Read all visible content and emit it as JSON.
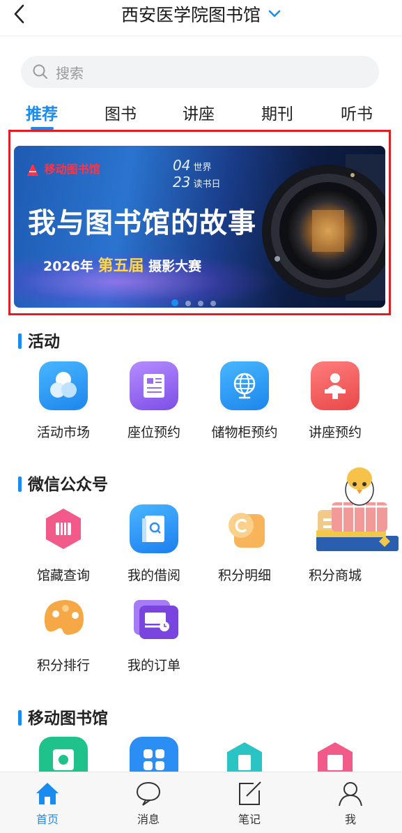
{
  "header": {
    "title": "西安医学院图书馆"
  },
  "search": {
    "placeholder": "搜索"
  },
  "tabs": [
    {
      "label": "推荐",
      "active": true
    },
    {
      "label": "图书",
      "active": false
    },
    {
      "label": "讲座",
      "active": false
    },
    {
      "label": "期刊",
      "active": false
    },
    {
      "label": "听书",
      "active": false
    }
  ],
  "banner": {
    "logo_text": "移动图书馆",
    "date_top_num": "04",
    "date_top_label": "世界",
    "date_bottom_num": "23",
    "date_bottom_label": "读书日",
    "headline": "我与图书馆的故事",
    "sub_year": "2026年",
    "sub_highlight": "第五届",
    "sub_rest": "摄影大赛",
    "slide_count": 4,
    "active_slide": 0
  },
  "sections": {
    "activities": {
      "title": "活动",
      "items": [
        {
          "label": "活动市场",
          "icon": "activity-market-icon",
          "color": "#2a9ef5"
        },
        {
          "label": "座位预约",
          "icon": "seat-reservation-icon",
          "color": "#9a6cf0"
        },
        {
          "label": "储物柜预约",
          "icon": "locker-reservation-icon",
          "color": "#2a9ef5"
        },
        {
          "label": "讲座预约",
          "icon": "lecture-reservation-icon",
          "color": "#f05a5a"
        }
      ]
    },
    "wechat": {
      "title": "微信公众号",
      "items": [
        {
          "label": "馆藏查询",
          "icon": "collection-search-icon",
          "color": "#f25a8a"
        },
        {
          "label": "我的借阅",
          "icon": "my-borrowing-icon",
          "color": "#2a8ef5"
        },
        {
          "label": "积分明细",
          "icon": "points-detail-icon",
          "color": "#f5a23a"
        },
        {
          "label": "积分商城",
          "icon": "points-mall-icon",
          "color": "#f0b060"
        },
        {
          "label": "积分排行",
          "icon": "points-ranking-icon",
          "color": "#f5a23a"
        },
        {
          "label": "我的订单",
          "icon": "my-orders-icon",
          "color": "#8a52e0"
        }
      ]
    },
    "mobile_library": {
      "title": "移动图书馆",
      "items": [
        {
          "icon": "mobile-lib-camera-icon",
          "color": "#1fc28a"
        },
        {
          "icon": "mobile-lib-apps-icon",
          "color": "#2a8ef5"
        },
        {
          "icon": "mobile-lib-doc-icon",
          "color": "#2ac4c4"
        },
        {
          "icon": "mobile-lib-news-icon",
          "color": "#f25a8a"
        }
      ]
    }
  },
  "bottom_nav": [
    {
      "label": "首页",
      "icon": "home-icon",
      "active": true
    },
    {
      "label": "消息",
      "icon": "message-icon",
      "active": false
    },
    {
      "label": "笔记",
      "icon": "note-icon",
      "active": false
    },
    {
      "label": "我",
      "icon": "profile-icon",
      "active": false
    }
  ],
  "colors": {
    "accent": "#1a8cf0",
    "highlight_frame": "#e01c24"
  }
}
